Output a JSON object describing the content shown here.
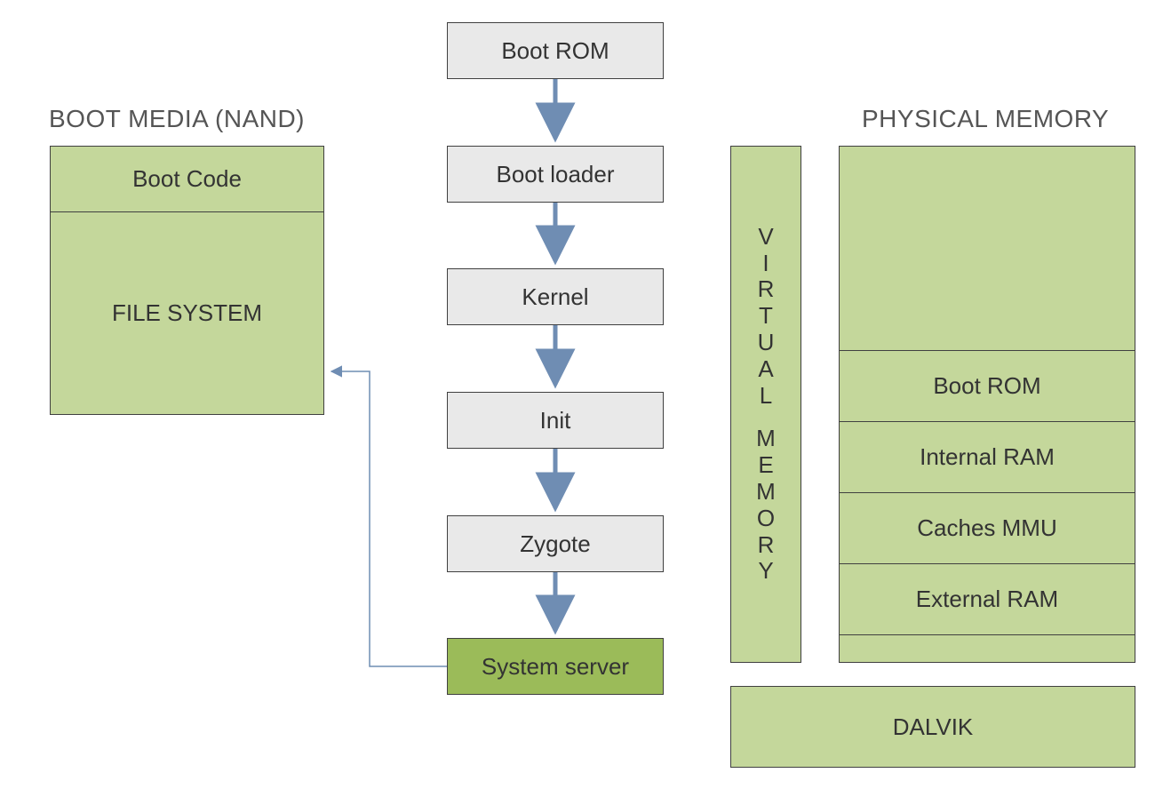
{
  "headings": {
    "boot_media": "BOOT MEDIA (NAND)",
    "phys_mem": "PHYSICAL MEMORY"
  },
  "flow": {
    "boot_rom": "Boot ROM",
    "boot_loader": "Boot loader",
    "kernel": "Kernel",
    "init": "Init",
    "zygote": "Zygote",
    "system_server": "System server"
  },
  "boot_media": {
    "boot_code": "Boot Code",
    "file_system": "FILE SYSTEM"
  },
  "virtual_memory": {
    "label_chars": [
      "V",
      "I",
      "R",
      "T",
      "U",
      "A",
      "L",
      "",
      "M",
      "E",
      "M",
      "O",
      "R",
      "Y"
    ]
  },
  "phys_mem": {
    "boot_rom": "Boot ROM",
    "internal_ram": "Internal RAM",
    "caches_mmu": "Caches MMU",
    "external_ram": "External RAM"
  },
  "dalvik": "DALVIK"
}
